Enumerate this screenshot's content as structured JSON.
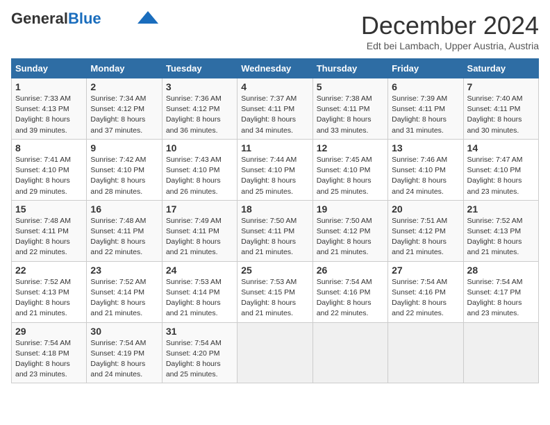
{
  "logo": {
    "general": "General",
    "blue": "Blue"
  },
  "header": {
    "month": "December 2024",
    "location": "Edt bei Lambach, Upper Austria, Austria"
  },
  "days_of_week": [
    "Sunday",
    "Monday",
    "Tuesday",
    "Wednesday",
    "Thursday",
    "Friday",
    "Saturday"
  ],
  "weeks": [
    [
      {
        "day": "1",
        "sunrise": "7:33 AM",
        "sunset": "4:13 PM",
        "daylight": "8 hours and 39 minutes."
      },
      {
        "day": "2",
        "sunrise": "7:34 AM",
        "sunset": "4:12 PM",
        "daylight": "8 hours and 37 minutes."
      },
      {
        "day": "3",
        "sunrise": "7:36 AM",
        "sunset": "4:12 PM",
        "daylight": "8 hours and 36 minutes."
      },
      {
        "day": "4",
        "sunrise": "7:37 AM",
        "sunset": "4:11 PM",
        "daylight": "8 hours and 34 minutes."
      },
      {
        "day": "5",
        "sunrise": "7:38 AM",
        "sunset": "4:11 PM",
        "daylight": "8 hours and 33 minutes."
      },
      {
        "day": "6",
        "sunrise": "7:39 AM",
        "sunset": "4:11 PM",
        "daylight": "8 hours and 31 minutes."
      },
      {
        "day": "7",
        "sunrise": "7:40 AM",
        "sunset": "4:11 PM",
        "daylight": "8 hours and 30 minutes."
      }
    ],
    [
      {
        "day": "8",
        "sunrise": "7:41 AM",
        "sunset": "4:10 PM",
        "daylight": "8 hours and 29 minutes."
      },
      {
        "day": "9",
        "sunrise": "7:42 AM",
        "sunset": "4:10 PM",
        "daylight": "8 hours and 28 minutes."
      },
      {
        "day": "10",
        "sunrise": "7:43 AM",
        "sunset": "4:10 PM",
        "daylight": "8 hours and 26 minutes."
      },
      {
        "day": "11",
        "sunrise": "7:44 AM",
        "sunset": "4:10 PM",
        "daylight": "8 hours and 25 minutes."
      },
      {
        "day": "12",
        "sunrise": "7:45 AM",
        "sunset": "4:10 PM",
        "daylight": "8 hours and 25 minutes."
      },
      {
        "day": "13",
        "sunrise": "7:46 AM",
        "sunset": "4:10 PM",
        "daylight": "8 hours and 24 minutes."
      },
      {
        "day": "14",
        "sunrise": "7:47 AM",
        "sunset": "4:10 PM",
        "daylight": "8 hours and 23 minutes."
      }
    ],
    [
      {
        "day": "15",
        "sunrise": "7:48 AM",
        "sunset": "4:11 PM",
        "daylight": "8 hours and 22 minutes."
      },
      {
        "day": "16",
        "sunrise": "7:48 AM",
        "sunset": "4:11 PM",
        "daylight": "8 hours and 22 minutes."
      },
      {
        "day": "17",
        "sunrise": "7:49 AM",
        "sunset": "4:11 PM",
        "daylight": "8 hours and 21 minutes."
      },
      {
        "day": "18",
        "sunrise": "7:50 AM",
        "sunset": "4:11 PM",
        "daylight": "8 hours and 21 minutes."
      },
      {
        "day": "19",
        "sunrise": "7:50 AM",
        "sunset": "4:12 PM",
        "daylight": "8 hours and 21 minutes."
      },
      {
        "day": "20",
        "sunrise": "7:51 AM",
        "sunset": "4:12 PM",
        "daylight": "8 hours and 21 minutes."
      },
      {
        "day": "21",
        "sunrise": "7:52 AM",
        "sunset": "4:13 PM",
        "daylight": "8 hours and 21 minutes."
      }
    ],
    [
      {
        "day": "22",
        "sunrise": "7:52 AM",
        "sunset": "4:13 PM",
        "daylight": "8 hours and 21 minutes."
      },
      {
        "day": "23",
        "sunrise": "7:52 AM",
        "sunset": "4:14 PM",
        "daylight": "8 hours and 21 minutes."
      },
      {
        "day": "24",
        "sunrise": "7:53 AM",
        "sunset": "4:14 PM",
        "daylight": "8 hours and 21 minutes."
      },
      {
        "day": "25",
        "sunrise": "7:53 AM",
        "sunset": "4:15 PM",
        "daylight": "8 hours and 21 minutes."
      },
      {
        "day": "26",
        "sunrise": "7:54 AM",
        "sunset": "4:16 PM",
        "daylight": "8 hours and 22 minutes."
      },
      {
        "day": "27",
        "sunrise": "7:54 AM",
        "sunset": "4:16 PM",
        "daylight": "8 hours and 22 minutes."
      },
      {
        "day": "28",
        "sunrise": "7:54 AM",
        "sunset": "4:17 PM",
        "daylight": "8 hours and 23 minutes."
      }
    ],
    [
      {
        "day": "29",
        "sunrise": "7:54 AM",
        "sunset": "4:18 PM",
        "daylight": "8 hours and 23 minutes."
      },
      {
        "day": "30",
        "sunrise": "7:54 AM",
        "sunset": "4:19 PM",
        "daylight": "8 hours and 24 minutes."
      },
      {
        "day": "31",
        "sunrise": "7:54 AM",
        "sunset": "4:20 PM",
        "daylight": "8 hours and 25 minutes."
      },
      null,
      null,
      null,
      null
    ]
  ]
}
